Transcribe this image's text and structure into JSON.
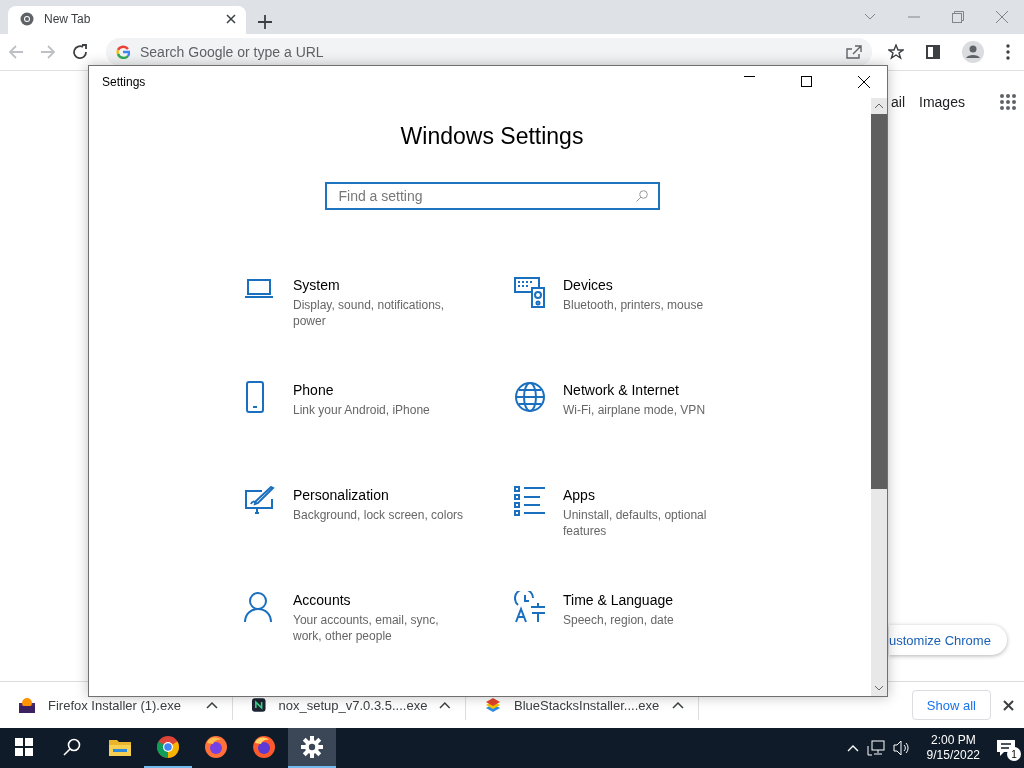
{
  "browser": {
    "tabs": [
      {
        "title": "New Tab",
        "selected": true
      }
    ],
    "address_bar": {
      "placeholder": "Search Google or type a URL"
    },
    "page": {
      "links": [
        "ail",
        "Images"
      ],
      "customize_button": "ustomize Chrome"
    },
    "downloads": [
      {
        "name": "Firefox Installer (1).exe",
        "kind": "firefox"
      },
      {
        "name": "nox_setup_v7.0.3.5....exe",
        "kind": "nox"
      },
      {
        "name": "BlueStacksInstaller....exe",
        "kind": "bluestacks"
      }
    ],
    "show_all": "Show all"
  },
  "settings_window": {
    "title": "Settings",
    "heading": "Windows Settings",
    "search": {
      "placeholder": "Find a setting"
    },
    "categories": [
      {
        "kind": "laptop",
        "title": "System",
        "description": "Display, sound, notifications, power"
      },
      {
        "kind": "devices",
        "title": "Devices",
        "description": "Bluetooth, printers, mouse"
      },
      {
        "kind": "phone",
        "title": "Phone",
        "description": "Link your Android, iPhone"
      },
      {
        "kind": "globe",
        "title": "Network & Internet",
        "description": "Wi-Fi, airplane mode, VPN"
      },
      {
        "kind": "brush",
        "title": "Personalization",
        "description": "Background, lock screen, colors"
      },
      {
        "kind": "apps",
        "title": "Apps",
        "description": "Uninstall, defaults, optional features"
      },
      {
        "kind": "person",
        "title": "Accounts",
        "description": "Your accounts, email, sync, work, other people"
      },
      {
        "kind": "time",
        "title": "Time & Language",
        "description": "Speech, region, date"
      }
    ]
  },
  "taskbar": {
    "items": [
      {
        "kind": "start"
      },
      {
        "kind": "search"
      },
      {
        "kind": "explorer",
        "running": false,
        "active": false
      },
      {
        "kind": "chrome",
        "running": true,
        "active": false
      },
      {
        "kind": "firefox",
        "running": false,
        "active": false
      },
      {
        "kind": "firefox-dev",
        "running": false,
        "active": false
      },
      {
        "kind": "gear",
        "running": true,
        "active": true
      }
    ],
    "time": "2:00 PM",
    "date": "9/15/2022",
    "notification_count": "1"
  }
}
